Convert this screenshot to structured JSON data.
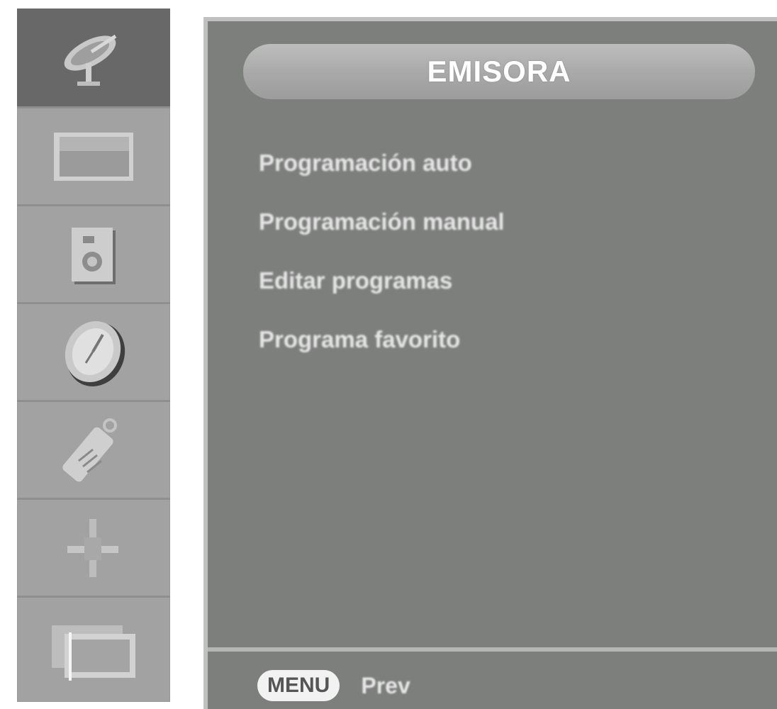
{
  "sidebar": {
    "items": [
      {
        "icon": "satellite-dish-icon",
        "active": true
      },
      {
        "icon": "picture-icon",
        "active": false
      },
      {
        "icon": "audio-icon",
        "active": false
      },
      {
        "icon": "clock-icon",
        "active": false
      },
      {
        "icon": "special-icon",
        "active": false
      },
      {
        "icon": "setup-icon",
        "active": false
      },
      {
        "icon": "screen-icon",
        "active": false
      }
    ]
  },
  "main": {
    "title": "EMISORA",
    "menu_items": [
      {
        "label": "Programación auto"
      },
      {
        "label": "Programación manual"
      },
      {
        "label": "Editar programas"
      },
      {
        "label": "Programa favorito"
      }
    ]
  },
  "footer": {
    "menu_key": "MENU",
    "hint": "Prev"
  },
  "colors": {
    "panel_bg": "#7d7f7d",
    "sidebar_bg": "#a2a2a2",
    "sidebar_active": "#686868",
    "text": "#e6e6e6"
  }
}
